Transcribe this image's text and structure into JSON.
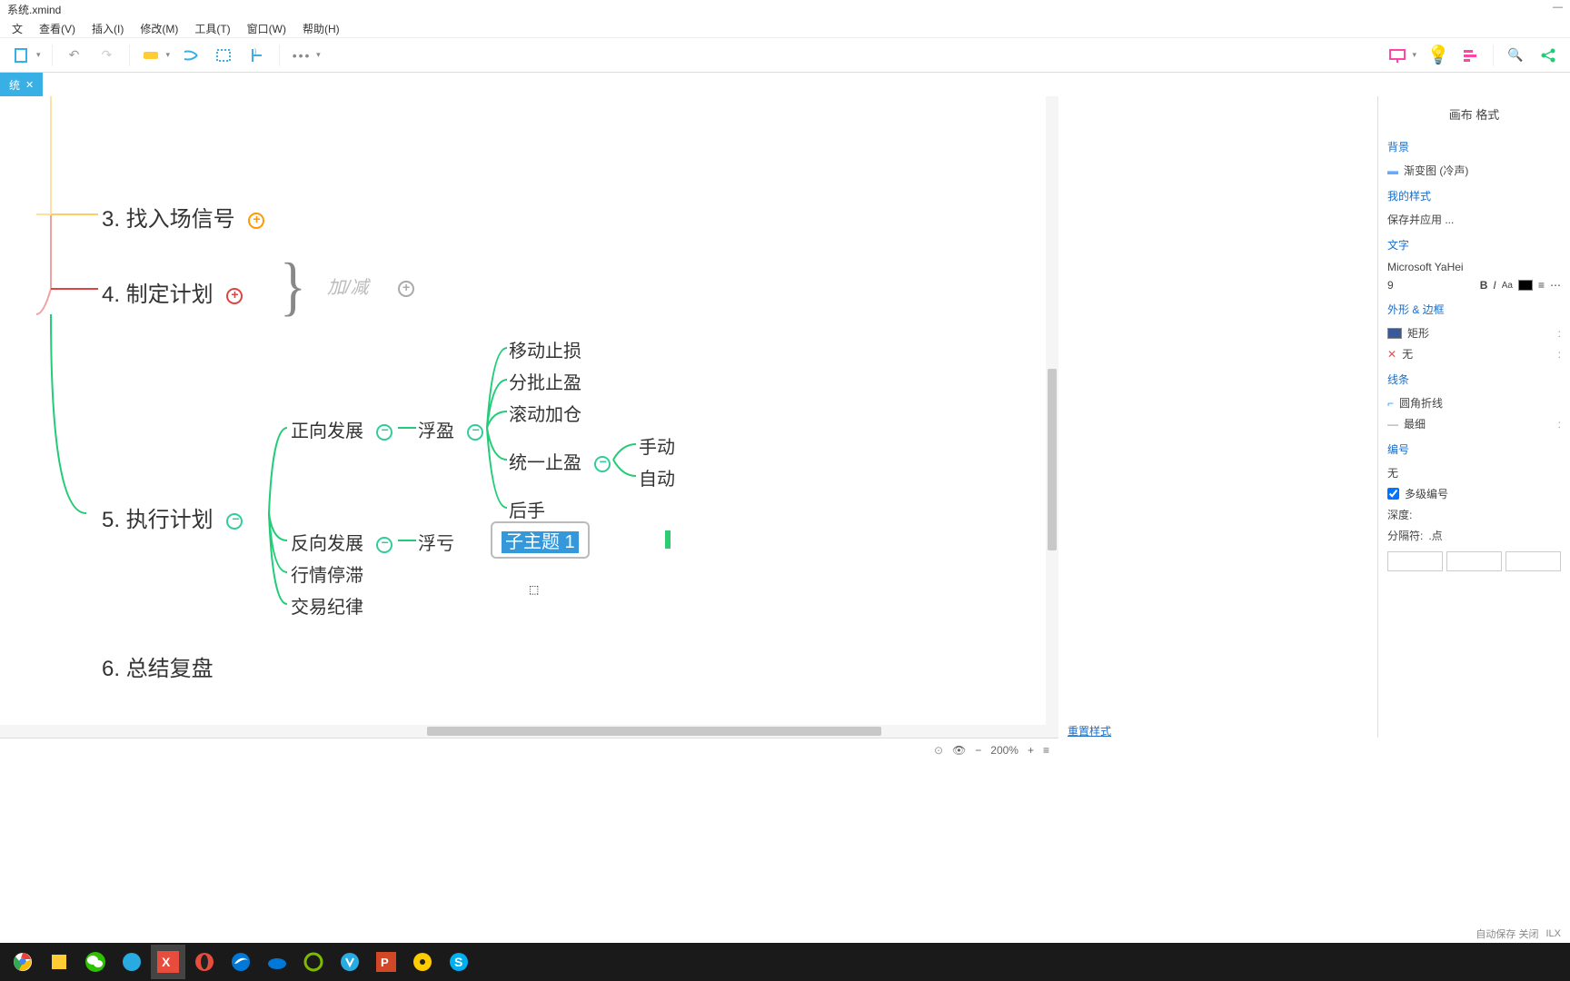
{
  "title": "系统.xmind",
  "menu": [
    "文",
    "查看(V)",
    "插入(I)",
    "修改(M)",
    "工具(T)",
    "窗口(W)",
    "帮助(H)"
  ],
  "tab": {
    "name": "统"
  },
  "canvas_status": {
    "zoom": "200%"
  },
  "mindmap": {
    "n3": "3. 找入场信号",
    "n4": "4. 制定计划",
    "n4_ghost": "加/减",
    "n5": "5. 执行计划",
    "forward": "正向发展",
    "backward": "反向发展",
    "stag": "行情停滞",
    "discipline": "交易纪律",
    "fuying": "浮盈",
    "fukui": "浮亏",
    "move_stop": "移动止损",
    "batch_profit": "分批止盈",
    "rolling": "滚动加仓",
    "unified_profit": "统一止盈",
    "backup": "后手",
    "manual": "手动",
    "auto": "自动",
    "n6": "6. 总结复盘",
    "editing": "子主题 1"
  },
  "sidebar": {
    "title": "画布 格式",
    "sec_bg": "背景",
    "bg_val": "渐变图 (冷声)",
    "sec_style": "我的样式",
    "style_btn": "保存并应用 ...",
    "sec_text": "文字",
    "font": "Microsoft YaHei",
    "size": "9",
    "sec_shape": "外形 & 边框",
    "shape_fill": "矩形",
    "shape_border": "无",
    "sec_line": "线条",
    "line_style": "圆角折线",
    "line_weight": "最细",
    "sec_num": "编号",
    "num_none": "无",
    "num_multi": "多级编号",
    "num_depth": "深度:",
    "num_sep_label": "分隔符: ",
    "num_sep": ".点",
    "reset": "重置样式"
  },
  "status": {
    "autosave": "自动保存 关闭",
    "suffix": "ILX"
  },
  "taskbar_icons": [
    "chrome",
    "files",
    "wechat",
    "globe",
    "xmind",
    "opera",
    "edge",
    "cloud",
    "circle",
    "wps",
    "ppt",
    "disc",
    "skype"
  ]
}
